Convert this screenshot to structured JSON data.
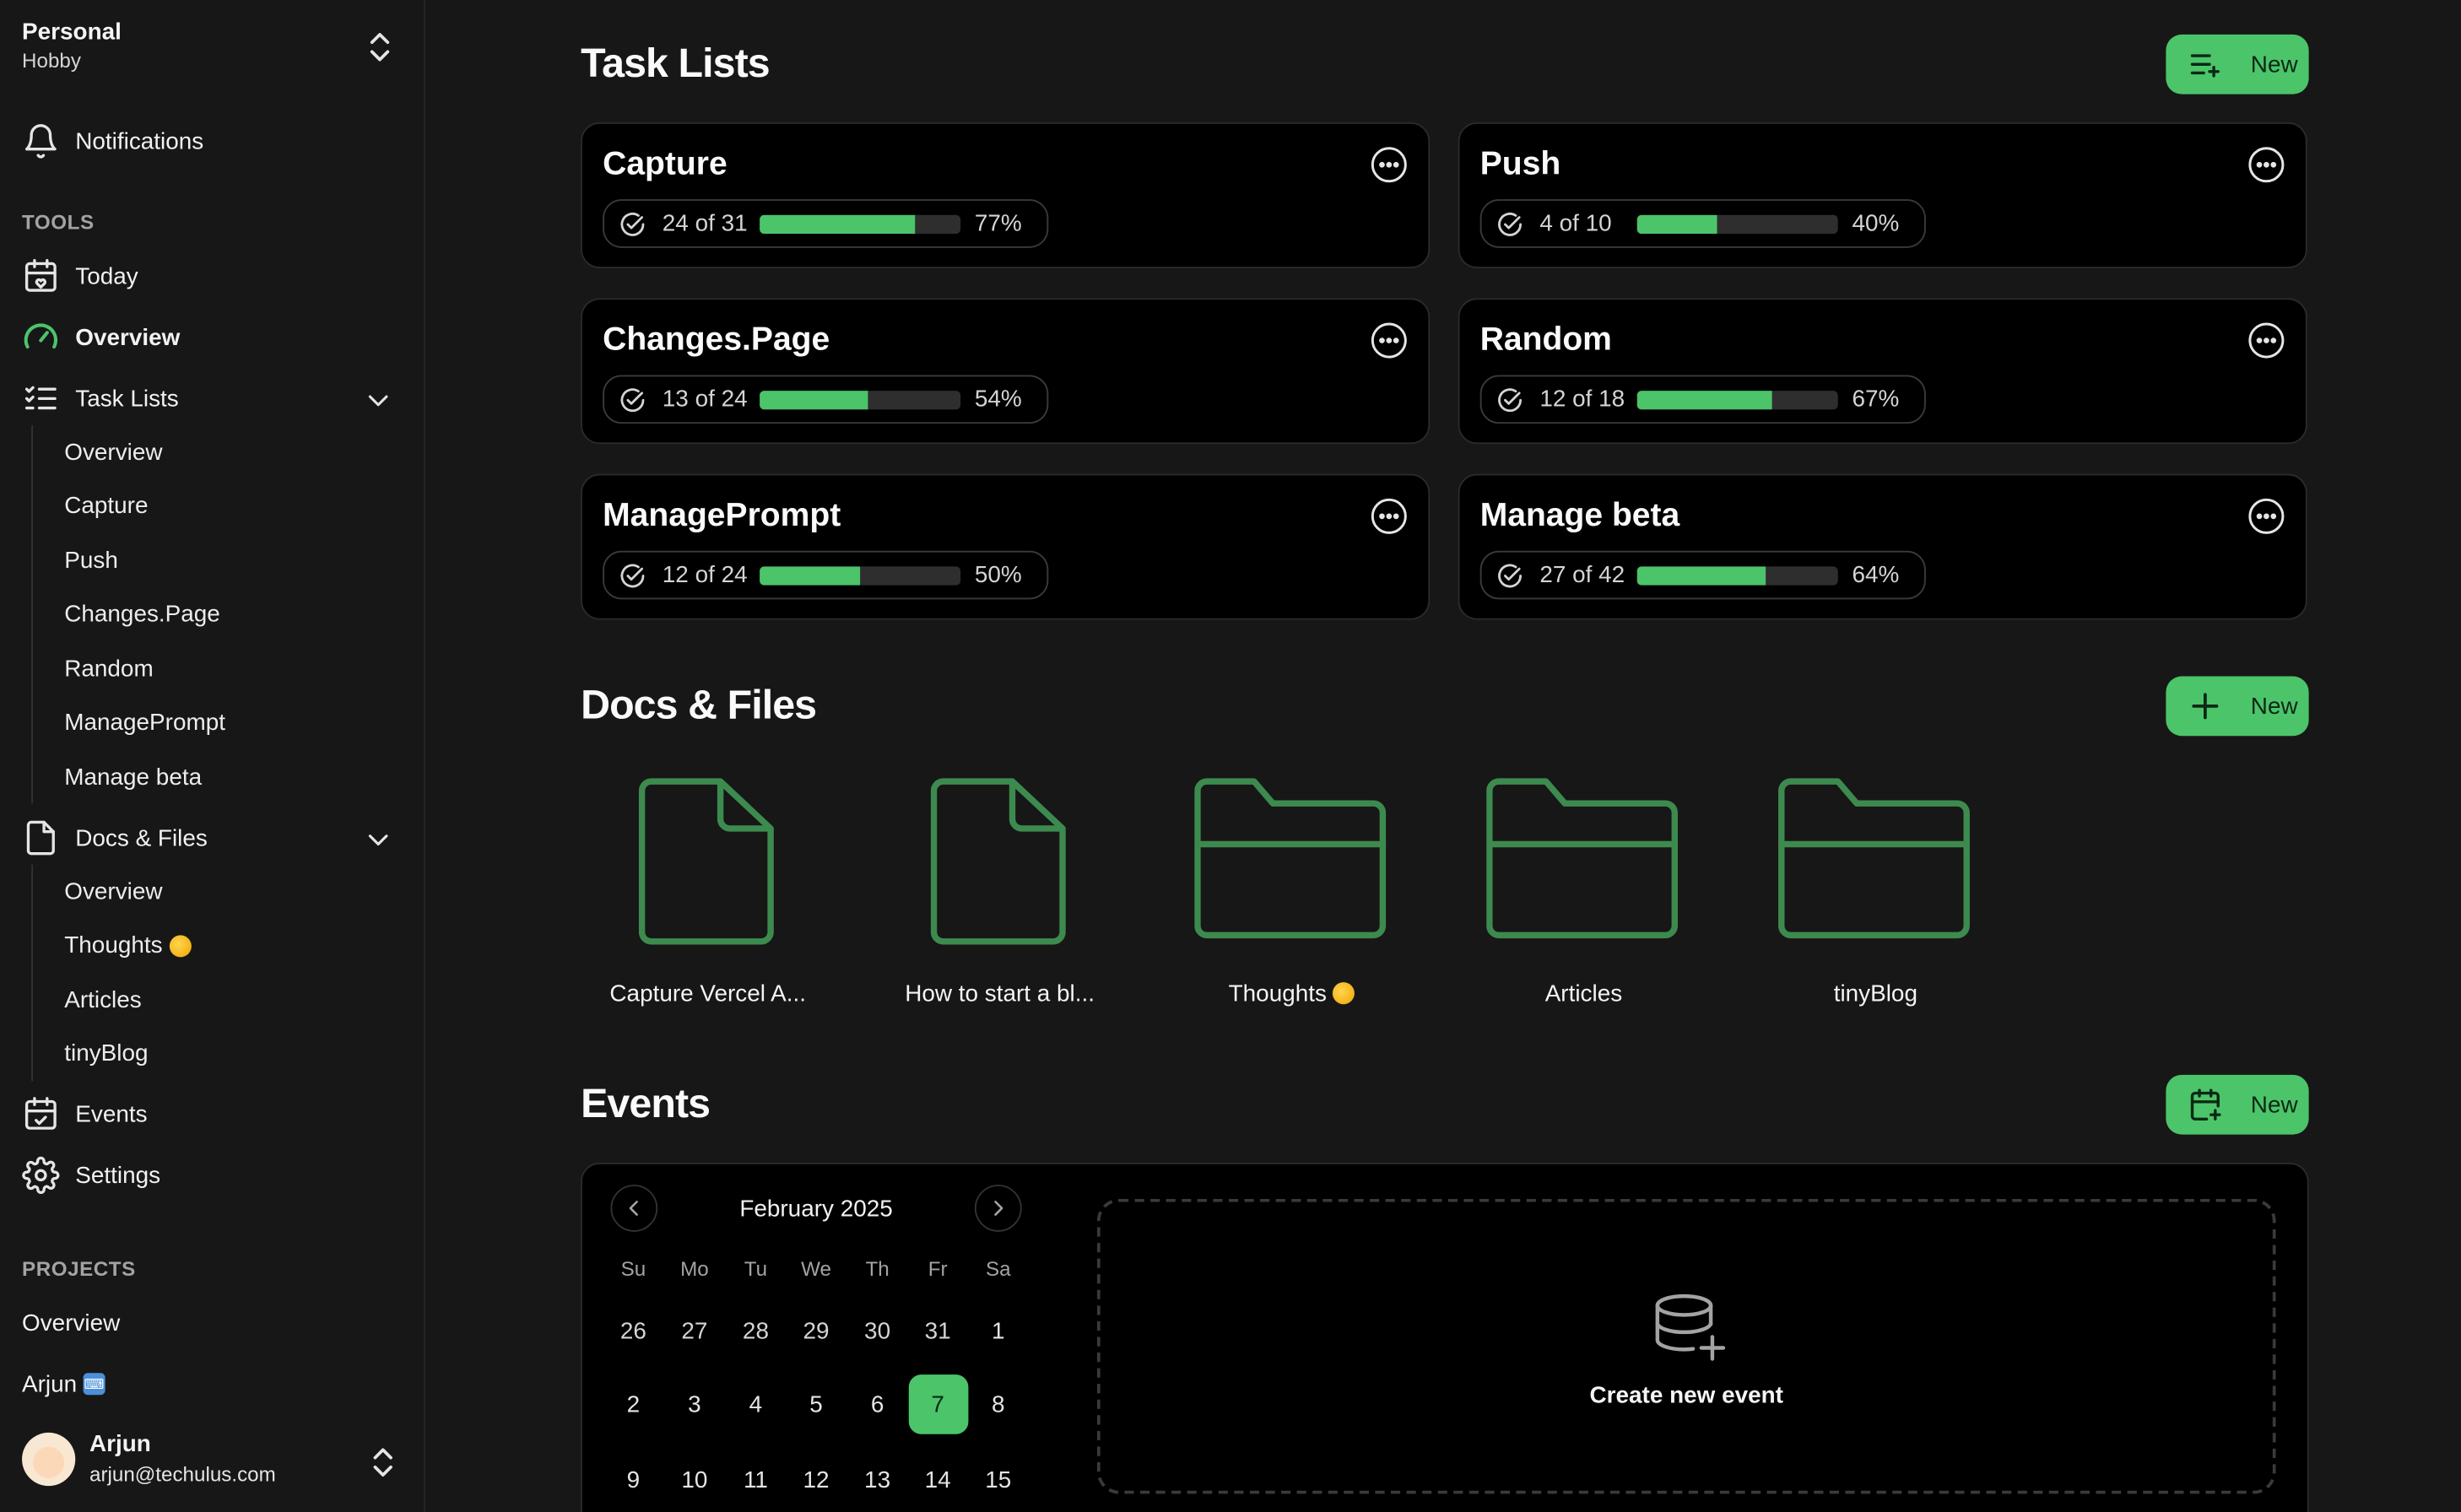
{
  "workspace": {
    "name": "Personal",
    "plan": "Hobby"
  },
  "sidebar": {
    "notifications": "Notifications",
    "tools_label": "TOOLS",
    "today": "Today",
    "overview": "Overview",
    "task_lists": "Task Lists",
    "task_list_items": [
      "Overview",
      "Capture",
      "Push",
      "Changes.Page",
      "Random",
      "ManagePrompt",
      "Manage beta"
    ],
    "docs_files": "Docs & Files",
    "docs_items": [
      "Overview",
      "Thoughts",
      "Articles",
      "tinyBlog"
    ],
    "events": "Events",
    "settings": "Settings",
    "projects_label": "PROJECTS",
    "projects_items": [
      "Overview",
      "Arjun"
    ]
  },
  "user": {
    "name": "Arjun",
    "email": "arjun@techulus.com"
  },
  "task_lists": {
    "title": "Task Lists",
    "new_label": "New",
    "cards": [
      {
        "name": "Capture",
        "count": "24 of 31",
        "pct_label": "77%",
        "progress": 0.77
      },
      {
        "name": "Push",
        "count": "4 of 10",
        "pct_label": "40%",
        "progress": 0.4
      },
      {
        "name": "Changes.Page",
        "count": "13 of 24",
        "pct_label": "54%",
        "progress": 0.54
      },
      {
        "name": "Random",
        "count": "12 of 18",
        "pct_label": "67%",
        "progress": 0.67
      },
      {
        "name": "ManagePrompt",
        "count": "12 of 24",
        "pct_label": "50%",
        "progress": 0.5
      },
      {
        "name": "Manage beta",
        "count": "27 of 42",
        "pct_label": "64%",
        "progress": 0.64
      }
    ]
  },
  "docs": {
    "title": "Docs & Files",
    "new_label": "New",
    "items": [
      {
        "name": "Capture Vercel A...",
        "kind": "file"
      },
      {
        "name": "How to start a bl...",
        "kind": "file"
      },
      {
        "name": "Thoughts",
        "kind": "folder"
      },
      {
        "name": "Articles",
        "kind": "folder"
      },
      {
        "name": "tinyBlog",
        "kind": "folder"
      }
    ]
  },
  "events": {
    "title": "Events",
    "new_label": "New",
    "calendar": {
      "month": "February 2025",
      "weekdays": [
        "Su",
        "Mo",
        "Tu",
        "We",
        "Th",
        "Fr",
        "Sa"
      ],
      "weeks": [
        [
          "26",
          "27",
          "28",
          "29",
          "30",
          "31",
          "1"
        ],
        [
          "2",
          "3",
          "4",
          "5",
          "6",
          "7",
          "8"
        ],
        [
          "9",
          "10",
          "11",
          "12",
          "13",
          "14",
          "15"
        ]
      ],
      "selected": "7"
    },
    "create_label": "Create new event"
  },
  "colors": {
    "accent": "#4cc46a",
    "background": "#171717",
    "card": "#000000"
  },
  "icons": [
    "chevrons-up-down-icon",
    "bell-icon",
    "calendar-heart-icon",
    "gauge-icon",
    "list-checks-icon",
    "chevron-down-icon",
    "file-icon",
    "calendar-check-icon",
    "gear-icon",
    "more-horizontal-icon",
    "check-circle-icon",
    "list-plus-icon",
    "plus-icon",
    "calendar-plus-icon",
    "folder-icon",
    "chevron-left-icon",
    "chevron-right-icon",
    "database-plus-icon"
  ]
}
